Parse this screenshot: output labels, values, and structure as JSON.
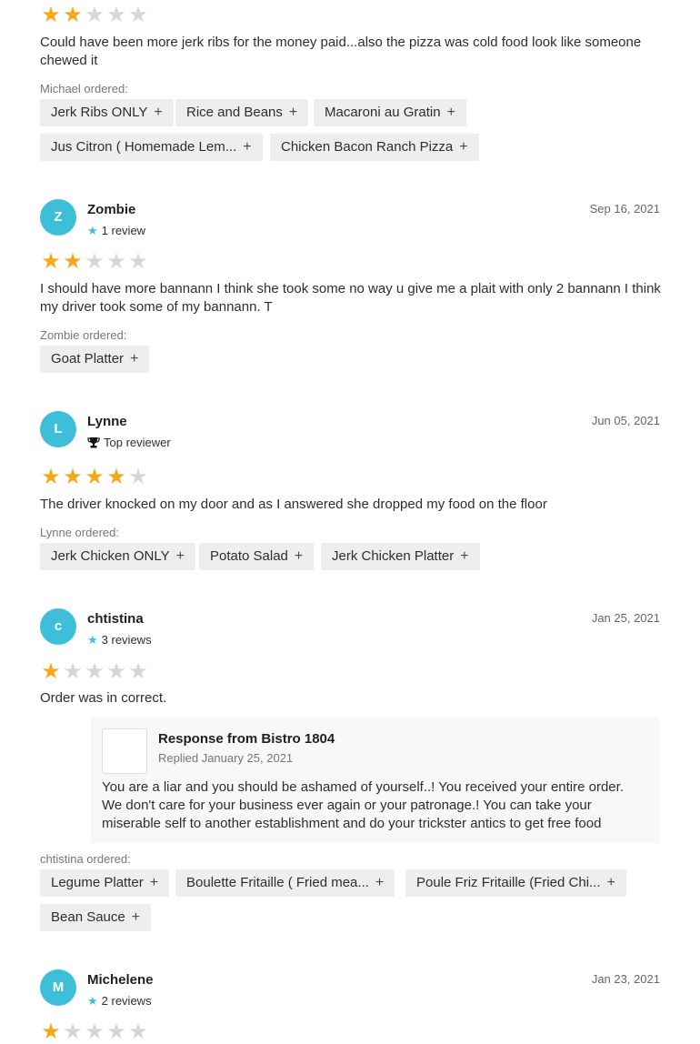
{
  "reviews": [
    {
      "rating": 2,
      "text": "Could have been more jerk ribs for the money paid...also the pizza was cold food look like someone chewed it",
      "ordered_label": "Michael ordered:",
      "items": [
        "Jerk Ribs ONLY",
        "Rice and Beans",
        "Macaroni au Gratin",
        "Jus Citron ( Homemade Lem...",
        "Chicken Bacon Ranch Pizza"
      ]
    },
    {
      "avatar": "Z",
      "name": "Zombie",
      "sub": "1 review",
      "date": "Sep 16, 2021",
      "rating": 2,
      "text": "I should have more bannann I think she took some no way u give me a plait with only 2 bannann I think my driver took some of my bannann. T",
      "ordered_label": "Zombie ordered:",
      "items": [
        "Goat Platter"
      ]
    },
    {
      "avatar": "L",
      "name": "Lynne",
      "sub": "Top reviewer",
      "date": "Jun 05, 2021",
      "rating": 4,
      "text": "The driver knocked on my door and as I answered she dropped my food on the floor",
      "ordered_label": "Lynne ordered:",
      "items": [
        "Jerk Chicken ONLY",
        "Potato Salad",
        "Jerk Chicken Platter"
      ]
    },
    {
      "avatar": "c",
      "name": "chtistina",
      "sub": "3 reviews",
      "date": "Jan 25, 2021",
      "rating": 1,
      "text": "Order was in correct.",
      "response": {
        "title": "Response from Bistro 1804",
        "replied": "Replied January 25, 2021",
        "text": "You are a liar and you should be ashamed of yourself..! You received your entire order. We don't care for your business ever again or your patronage.! You can take your miserable self to another establishment and do your trickster antics to get free food"
      },
      "ordered_label": "chtistina ordered:",
      "items": [
        "Legume Platter",
        "Boulette Fritaille ( Fried mea...",
        "Poule Friz Fritaille (Fried Chi...",
        "Bean Sauce"
      ]
    },
    {
      "avatar": "M",
      "name": "Michelene",
      "sub": "2 reviews",
      "date": "Jan 23, 2021",
      "rating": 1
    }
  ],
  "icons": {
    "star": "star-icon",
    "plus": "plus-icon",
    "trophy": "trophy-icon"
  },
  "colors": {
    "star_on": "#f6a81c",
    "star_off": "#d6d6d6",
    "avatar_bg": "#3ebfd9",
    "chip_bg": "#eeeeee"
  }
}
